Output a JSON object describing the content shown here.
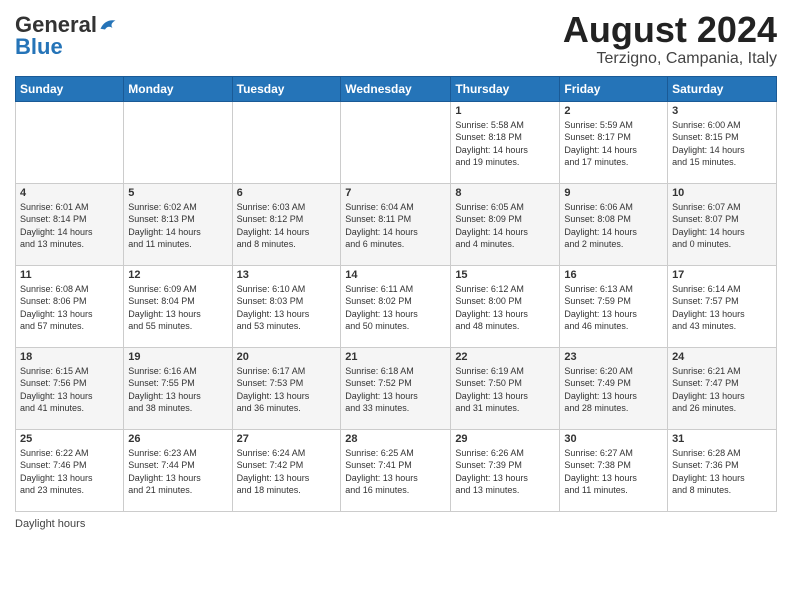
{
  "header": {
    "logo_general": "General",
    "logo_blue": "Blue",
    "month_year": "August 2024",
    "location": "Terzigno, Campania, Italy"
  },
  "calendar": {
    "days_header": [
      "Sunday",
      "Monday",
      "Tuesday",
      "Wednesday",
      "Thursday",
      "Friday",
      "Saturday"
    ],
    "weeks": [
      [
        {
          "day": "",
          "info": ""
        },
        {
          "day": "",
          "info": ""
        },
        {
          "day": "",
          "info": ""
        },
        {
          "day": "",
          "info": ""
        },
        {
          "day": "1",
          "info": "Sunrise: 5:58 AM\nSunset: 8:18 PM\nDaylight: 14 hours\nand 19 minutes."
        },
        {
          "day": "2",
          "info": "Sunrise: 5:59 AM\nSunset: 8:17 PM\nDaylight: 14 hours\nand 17 minutes."
        },
        {
          "day": "3",
          "info": "Sunrise: 6:00 AM\nSunset: 8:15 PM\nDaylight: 14 hours\nand 15 minutes."
        }
      ],
      [
        {
          "day": "4",
          "info": "Sunrise: 6:01 AM\nSunset: 8:14 PM\nDaylight: 14 hours\nand 13 minutes."
        },
        {
          "day": "5",
          "info": "Sunrise: 6:02 AM\nSunset: 8:13 PM\nDaylight: 14 hours\nand 11 minutes."
        },
        {
          "day": "6",
          "info": "Sunrise: 6:03 AM\nSunset: 8:12 PM\nDaylight: 14 hours\nand 8 minutes."
        },
        {
          "day": "7",
          "info": "Sunrise: 6:04 AM\nSunset: 8:11 PM\nDaylight: 14 hours\nand 6 minutes."
        },
        {
          "day": "8",
          "info": "Sunrise: 6:05 AM\nSunset: 8:09 PM\nDaylight: 14 hours\nand 4 minutes."
        },
        {
          "day": "9",
          "info": "Sunrise: 6:06 AM\nSunset: 8:08 PM\nDaylight: 14 hours\nand 2 minutes."
        },
        {
          "day": "10",
          "info": "Sunrise: 6:07 AM\nSunset: 8:07 PM\nDaylight: 14 hours\nand 0 minutes."
        }
      ],
      [
        {
          "day": "11",
          "info": "Sunrise: 6:08 AM\nSunset: 8:06 PM\nDaylight: 13 hours\nand 57 minutes."
        },
        {
          "day": "12",
          "info": "Sunrise: 6:09 AM\nSunset: 8:04 PM\nDaylight: 13 hours\nand 55 minutes."
        },
        {
          "day": "13",
          "info": "Sunrise: 6:10 AM\nSunset: 8:03 PM\nDaylight: 13 hours\nand 53 minutes."
        },
        {
          "day": "14",
          "info": "Sunrise: 6:11 AM\nSunset: 8:02 PM\nDaylight: 13 hours\nand 50 minutes."
        },
        {
          "day": "15",
          "info": "Sunrise: 6:12 AM\nSunset: 8:00 PM\nDaylight: 13 hours\nand 48 minutes."
        },
        {
          "day": "16",
          "info": "Sunrise: 6:13 AM\nSunset: 7:59 PM\nDaylight: 13 hours\nand 46 minutes."
        },
        {
          "day": "17",
          "info": "Sunrise: 6:14 AM\nSunset: 7:57 PM\nDaylight: 13 hours\nand 43 minutes."
        }
      ],
      [
        {
          "day": "18",
          "info": "Sunrise: 6:15 AM\nSunset: 7:56 PM\nDaylight: 13 hours\nand 41 minutes."
        },
        {
          "day": "19",
          "info": "Sunrise: 6:16 AM\nSunset: 7:55 PM\nDaylight: 13 hours\nand 38 minutes."
        },
        {
          "day": "20",
          "info": "Sunrise: 6:17 AM\nSunset: 7:53 PM\nDaylight: 13 hours\nand 36 minutes."
        },
        {
          "day": "21",
          "info": "Sunrise: 6:18 AM\nSunset: 7:52 PM\nDaylight: 13 hours\nand 33 minutes."
        },
        {
          "day": "22",
          "info": "Sunrise: 6:19 AM\nSunset: 7:50 PM\nDaylight: 13 hours\nand 31 minutes."
        },
        {
          "day": "23",
          "info": "Sunrise: 6:20 AM\nSunset: 7:49 PM\nDaylight: 13 hours\nand 28 minutes."
        },
        {
          "day": "24",
          "info": "Sunrise: 6:21 AM\nSunset: 7:47 PM\nDaylight: 13 hours\nand 26 minutes."
        }
      ],
      [
        {
          "day": "25",
          "info": "Sunrise: 6:22 AM\nSunset: 7:46 PM\nDaylight: 13 hours\nand 23 minutes."
        },
        {
          "day": "26",
          "info": "Sunrise: 6:23 AM\nSunset: 7:44 PM\nDaylight: 13 hours\nand 21 minutes."
        },
        {
          "day": "27",
          "info": "Sunrise: 6:24 AM\nSunset: 7:42 PM\nDaylight: 13 hours\nand 18 minutes."
        },
        {
          "day": "28",
          "info": "Sunrise: 6:25 AM\nSunset: 7:41 PM\nDaylight: 13 hours\nand 16 minutes."
        },
        {
          "day": "29",
          "info": "Sunrise: 6:26 AM\nSunset: 7:39 PM\nDaylight: 13 hours\nand 13 minutes."
        },
        {
          "day": "30",
          "info": "Sunrise: 6:27 AM\nSunset: 7:38 PM\nDaylight: 13 hours\nand 11 minutes."
        },
        {
          "day": "31",
          "info": "Sunrise: 6:28 AM\nSunset: 7:36 PM\nDaylight: 13 hours\nand 8 minutes."
        }
      ]
    ]
  },
  "footer": {
    "daylight_label": "Daylight hours"
  }
}
